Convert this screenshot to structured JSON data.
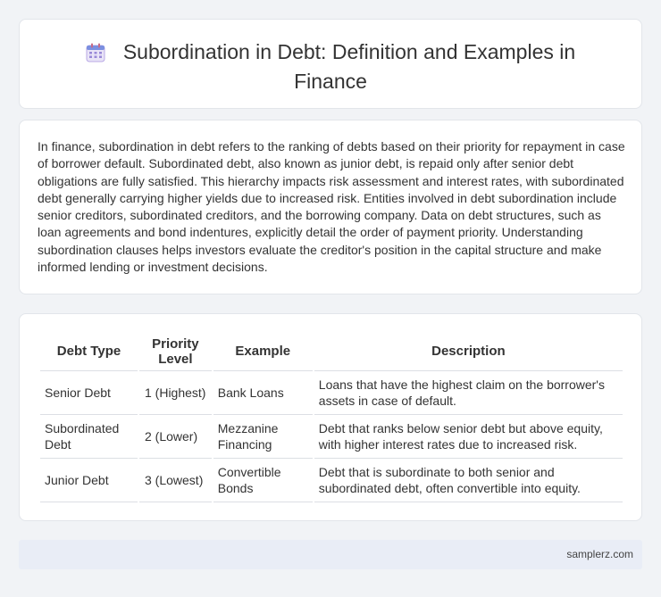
{
  "header": {
    "icon": "calendar-icon",
    "title_line1": "Subordination in Debt: Definition and Examples in",
    "title_line2": "Finance"
  },
  "intro": {
    "text": "In finance, subordination in debt refers to the ranking of debts based on their priority for repayment in case of borrower default. Subordinated debt, also known as junior debt, is repaid only after senior debt obligations are fully satisfied. This hierarchy impacts risk assessment and interest rates, with subordinated debt generally carrying higher yields due to increased risk. Entities involved in debt subordination include senior creditors, subordinated creditors, and the borrowing company. Data on debt structures, such as loan agreements and bond indentures, explicitly detail the order of payment priority. Understanding subordination clauses helps investors evaluate the creditor's position in the capital structure and make informed lending or investment decisions."
  },
  "table": {
    "headers": [
      "Debt Type",
      "Priority Level",
      "Example",
      "Description"
    ],
    "rows": [
      {
        "debt_type": "Senior Debt",
        "priority": "1 (Highest)",
        "example": "Bank Loans",
        "description": "Loans that have the highest claim on the borrower's assets in case of default."
      },
      {
        "debt_type": "Subordinated Debt",
        "priority": "2 (Lower)",
        "example": "Mezzanine Financing",
        "description": "Debt that ranks below senior debt but above equity, with higher interest rates due to increased risk."
      },
      {
        "debt_type": "Junior Debt",
        "priority": "3 (Lowest)",
        "example": "Convertible Bonds",
        "description": "Debt that is subordinate to both senior and subordinated debt, often convertible into equity."
      }
    ]
  },
  "footer": {
    "site": "samplerz.com"
  }
}
